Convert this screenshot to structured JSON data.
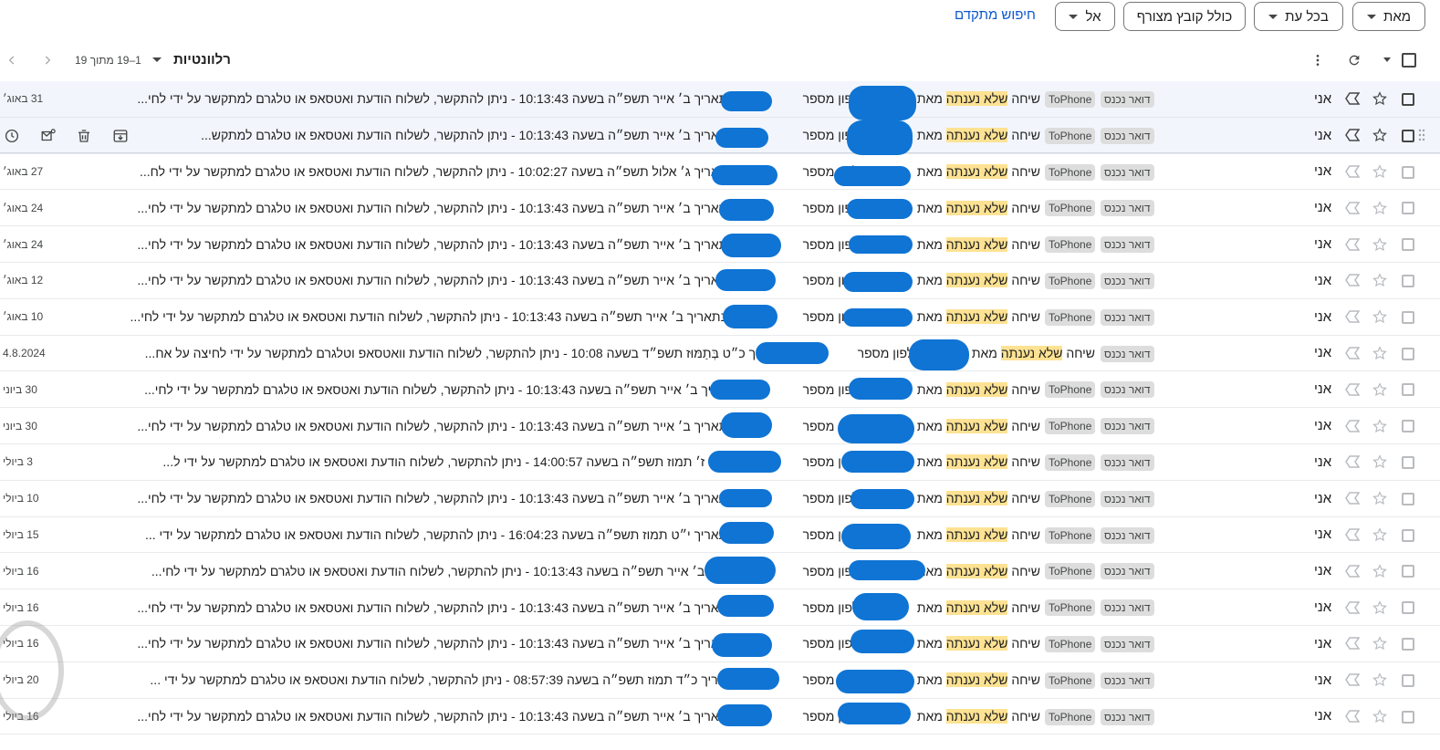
{
  "filters": {
    "from_label": "מאת",
    "anytime_label": "בכל עת",
    "attachment_label": "כולל קובץ מצורף",
    "to_label": "אל",
    "advanced_search": "חיפוש מתקדם"
  },
  "toolbar": {
    "sort_label": "רלוונטיות",
    "page_count": "1–19 מתוך 19"
  },
  "labels": {
    "inbox": "דואר נכנס",
    "tophone": "ToPhone"
  },
  "colors": {
    "highlight": "#fde293",
    "redaction": "#0f74d4",
    "link": "#0b57d0"
  },
  "rows": [
    {
      "sender": "אני",
      "subject": "שיחה",
      "hl": "שלא נענתה",
      "mid": "מאת",
      "num": "מספר",
      "phone": "טלפון",
      "body": "055 בתאריך ב׳ אייר תשפ״ה בשעה 10:13:43 - ניתן להתקשר, לשלוח הודעת ואטסאפ או טלגרם למתקשר על ידי לחי...",
      "date": "31 באוג׳",
      "tophone": true
    },
    {
      "sender": "אני",
      "subject": "שיחה",
      "hl": "שלא נענתה",
      "mid": "מאת",
      "num": "מספר",
      "phone": "טלפון",
      "body": "055 בתאריך ב׳ אייר תשפ״ה בשעה 10:13:43 - ניתן להתקשר, לשלוח הודעת ואטסאפ או טלגרם למתקש...",
      "date": "",
      "tophone": true
    },
    {
      "sender": "אני",
      "subject": "שיחה",
      "hl": "שלא נענתה",
      "mid": "מאת",
      "num": "מספר",
      "phone": "טלפון",
      "body": "055 בתאריך ג׳ אלול תשפ״ה בשעה 10:02:27 - ניתן להתקשר, לשלוח הודעת ואטסאפ או טלגרם למתקשר על ידי לח...",
      "date": "27 באוג׳",
      "tophone": true
    },
    {
      "sender": "אני",
      "subject": "שיחה",
      "hl": "שלא נענתה",
      "mid": "מאת",
      "num": "מספר",
      "phone": "טלפון",
      "body": "055 בתאריך ב׳ אייר תשפ״ה בשעה 10:13:43 - ניתן להתקשר, לשלוח הודעת ואטסאפ או טלגרם למתקשר על ידי לחי...",
      "date": "24 באוג׳",
      "tophone": true
    },
    {
      "sender": "אני",
      "subject": "שיחה",
      "hl": "שלא נענתה",
      "mid": "מאת",
      "num": "מספר",
      "phone": "טלפון",
      "body": "055 בתאריך ב׳ אייר תשפ״ה בשעה 10:13:43 - ניתן להתקשר, לשלוח הודעת ואטסאפ או טלגרם למתקשר על ידי לחי...",
      "date": "24 באוג׳",
      "tophone": true
    },
    {
      "sender": "אני",
      "subject": "שיחה",
      "hl": "שלא נענתה",
      "mid": "מאת",
      "num": "מספר",
      "phone": "טלפון",
      "body": "055 בתאריך ב׳ אייר תשפ״ה בשעה 10:13:43 - ניתן להתקשר, לשלוח הודעת ואטסאפ או טלגרם למתקשר על ידי לחי...",
      "date": "12 באוג׳",
      "tophone": true
    },
    {
      "sender": "אני",
      "subject": "שיחה",
      "hl": "שלא נענתה",
      "mid": "מאת",
      "num": "מספר",
      "phone": "טלפון",
      "body": "0556 בתאריך ב׳ אייר תשפ״ה בשעה 10:13:43 - ניתן להתקשר, לשלוח הודעת ואטסאפ או טלגרם למתקשר על ידי לחי...",
      "date": "10 באוג׳",
      "tophone": true
    },
    {
      "sender": "אני",
      "subject": "שיחה",
      "hl": "שלא נענתה",
      "mid": "מאת",
      "num": "מספר",
      "phone": "טלפון",
      "body": "055 בתאריך כ״ט בְּתַמּוּז תשפ״ד בשעה 10:08 - ניתן להתקשר, לשלוח הודעת וואטסאפ וטלגרם למתקשר על ידי לחיצה על אח...",
      "date": "4.8.2024",
      "tophone": false
    },
    {
      "sender": "אני",
      "subject": "שיחה",
      "hl": "שלא נענתה",
      "mid": "מאת",
      "num": "מספר",
      "phone": "טלפון",
      "body": "05 בתאריך ב׳ אייר תשפ״ה בשעה 10:13:43 - ניתן להתקשר, לשלוח הודעת ואטסאפ או טלגרם למתקשר על ידי לחי...",
      "date": "30 ביוני",
      "tophone": true
    },
    {
      "sender": "אני",
      "subject": "שיחה",
      "hl": "שלא נענתה",
      "mid": "מאת",
      "num": "מספר",
      "phone": "טלפון",
      "body": "055 בתאריך ב׳ אייר תשפ״ה בשעה 10:13:43 - ניתן להתקשר, לשלוח הודעת ואטסאפ או טלגרם למתקשר על ידי לחי...",
      "date": "30 ביוני",
      "tophone": true
    },
    {
      "sender": "אני",
      "subject": "שיחה",
      "hl": "שלא נענתה",
      "mid": "מאת",
      "num": "מספר",
      "phone": "טלפון",
      "body": "0 בתאריך ז׳ תמוז תשפ״ה בשעה 14:00:57 - ניתן להתקשר, לשלוח הודעת ואטסאפ או טלגרם למתקשר על ידי ל...",
      "date": "3 ביולי",
      "tophone": true
    },
    {
      "sender": "אני",
      "subject": "שיחה",
      "hl": "שלא נענתה",
      "mid": "מאת",
      "num": "מספר",
      "phone": "טלפון",
      "body": "055 בתאריך ב׳ אייר תשפ״ה בשעה 10:13:43 - ניתן להתקשר, לשלוח הודעת ואטסאפ או טלגרם למתקשר על ידי לחי...",
      "date": "10 ביולי",
      "tophone": true
    },
    {
      "sender": "אני",
      "subject": "שיחה",
      "hl": "שלא נענתה",
      "mid": "מאת",
      "num": "מספר",
      "phone": "טלפון",
      "body": "055 בתאריך י״ט תמוז תשפ״ה בשעה 16:04:23 - ניתן להתקשר, לשלוח הודעת ואטסאפ או טלגרם למתקשר על ידי ...",
      "date": "15 ביולי",
      "tophone": true
    },
    {
      "sender": "אני",
      "subject": "שיחה",
      "hl": "שלא נענתה",
      "mid": "מאת",
      "num": "מספר",
      "phone": "טלפון",
      "body": "0 בתאריך ב׳ אייר תשפ״ה בשעה 10:13:43 - ניתן להתקשר, לשלוח הודעת ואטסאפ או טלגרם למתקשר על ידי לחי...",
      "date": "16 ביולי",
      "tophone": true
    },
    {
      "sender": "אני",
      "subject": "שיחה",
      "hl": "שלא נענתה",
      "mid": "מאת",
      "num": "מספר",
      "phone": "טלפון",
      "body": "055 בתאריך ב׳ אייר תשפ״ה בשעה 10:13:43 - ניתן להתקשר, לשלוח הודעת ואטסאפ או טלגרם למתקשר על ידי לחי...",
      "date": "16 ביולי",
      "tophone": true
    },
    {
      "sender": "אני",
      "subject": "שיחה",
      "hl": "שלא נענתה",
      "mid": "מאת",
      "num": "מספר",
      "phone": "טלפון",
      "body": "055 בתאריך ב׳ אייר תשפ״ה בשעה 10:13:43 - ניתן להתקשר, לשלוח הודעת ואטסאפ או טלגרם למתקשר על ידי לחי...",
      "date": "16 ביולי",
      "tophone": true
    },
    {
      "sender": "אני",
      "subject": "שיחה",
      "hl": "שלא נענתה",
      "mid": "מאת",
      "num": "מספר",
      "phone": "טלפון",
      "body": "05 בתאריך כ״ד תמוז תשפ״ה בשעה 08:57:39 - ניתן להתקשר, לשלוח הודעת ואטסאפ או טלגרם למתקשר על ידי ...",
      "date": "20 ביולי",
      "tophone": true
    },
    {
      "sender": "אני",
      "subject": "שיחה",
      "hl": "שלא נענתה",
      "mid": "מאת",
      "num": "מספר",
      "phone": "טלפון",
      "body": "055 בתאריך ב׳ אייר תשפ״ה בשעה 10:13:43 - ניתן להתקשר, לשלוח הודעת ואטסאפ או טלגרם למתקשר על ידי לחי...",
      "date": "16 ביולי",
      "tophone": true
    }
  ]
}
